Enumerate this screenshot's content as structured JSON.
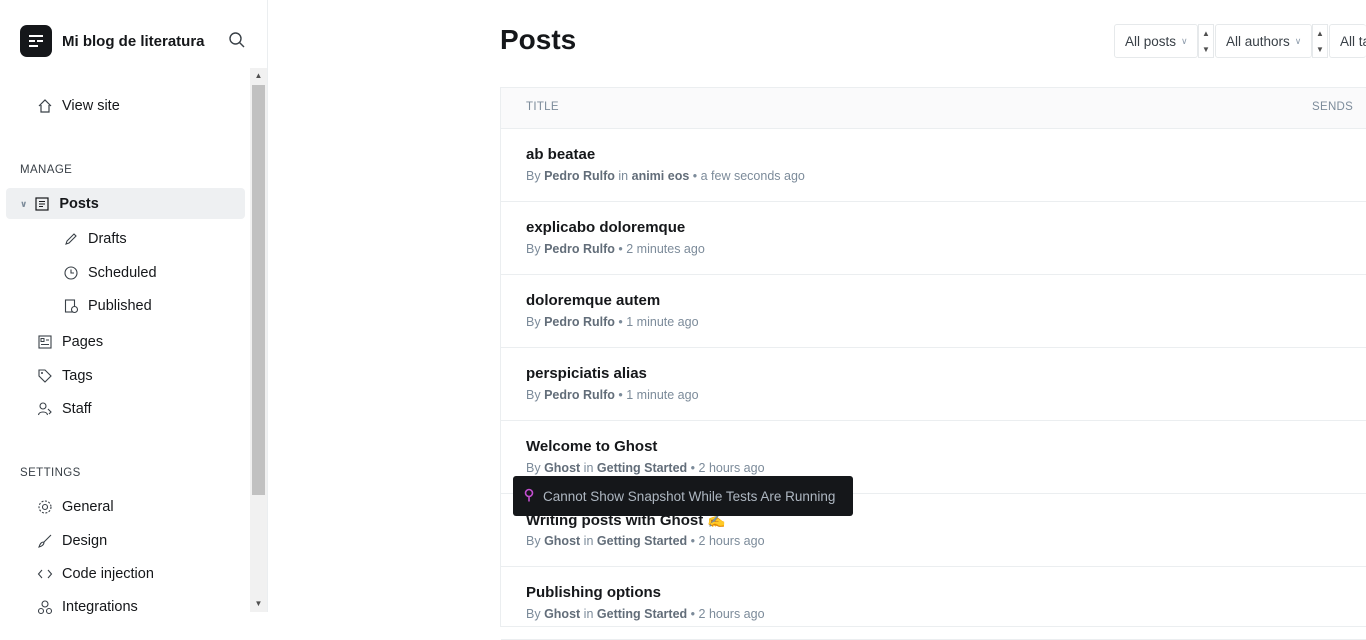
{
  "sidebar": {
    "site_title": "Mi blog de literatura",
    "view_site": "View site",
    "manage_label": "MANAGE",
    "posts": "Posts",
    "drafts": "Drafts",
    "scheduled": "Scheduled",
    "published": "Published",
    "pages": "Pages",
    "tags": "Tags",
    "staff": "Staff",
    "settings_label": "SETTINGS",
    "general": "General",
    "design": "Design",
    "code_injection": "Code injection",
    "integrations": "Integrations"
  },
  "main": {
    "title": "Posts",
    "filters": {
      "type": "All posts",
      "authors": "All authors",
      "tags": "All tags"
    },
    "columns": {
      "title": "TITLE",
      "sends": "SENDS"
    },
    "rows": [
      {
        "title": "ab beatae",
        "by": "By",
        "author": "Pedro Rulfo",
        "in": "in",
        "tag": "animi eos",
        "time": "• a few seconds ago"
      },
      {
        "title": "explicabo doloremque",
        "by": "By",
        "author": "Pedro Rulfo",
        "in": "",
        "tag": "",
        "time": "• 2 minutes ago"
      },
      {
        "title": "doloremque autem",
        "by": "By",
        "author": "Pedro Rulfo",
        "in": "",
        "tag": "",
        "time": "• 1 minute ago"
      },
      {
        "title": "perspiciatis alias",
        "by": "By",
        "author": "Pedro Rulfo",
        "in": "",
        "tag": "",
        "time": "• 1 minute ago"
      },
      {
        "title": "Welcome to Ghost",
        "by": "By",
        "author": "Ghost",
        "in": "in",
        "tag": "Getting Started",
        "time": "• 2 hours ago"
      },
      {
        "title": "Writing posts with Ghost ✍️",
        "by": "By",
        "author": "Ghost",
        "in": "in",
        "tag": "Getting Started",
        "time": "• 2 hours ago"
      },
      {
        "title": "Publishing options",
        "by": "By",
        "author": "Ghost",
        "in": "in",
        "tag": "Getting Started",
        "time": "• 2 hours ago"
      }
    ]
  },
  "tooltip": {
    "text": "Cannot Show Snapshot While Tests Are Running"
  },
  "colors": {
    "accent_dark": "#15171a",
    "muted": "#7c8b9a",
    "tooltip_pin": "#c44fd1"
  }
}
